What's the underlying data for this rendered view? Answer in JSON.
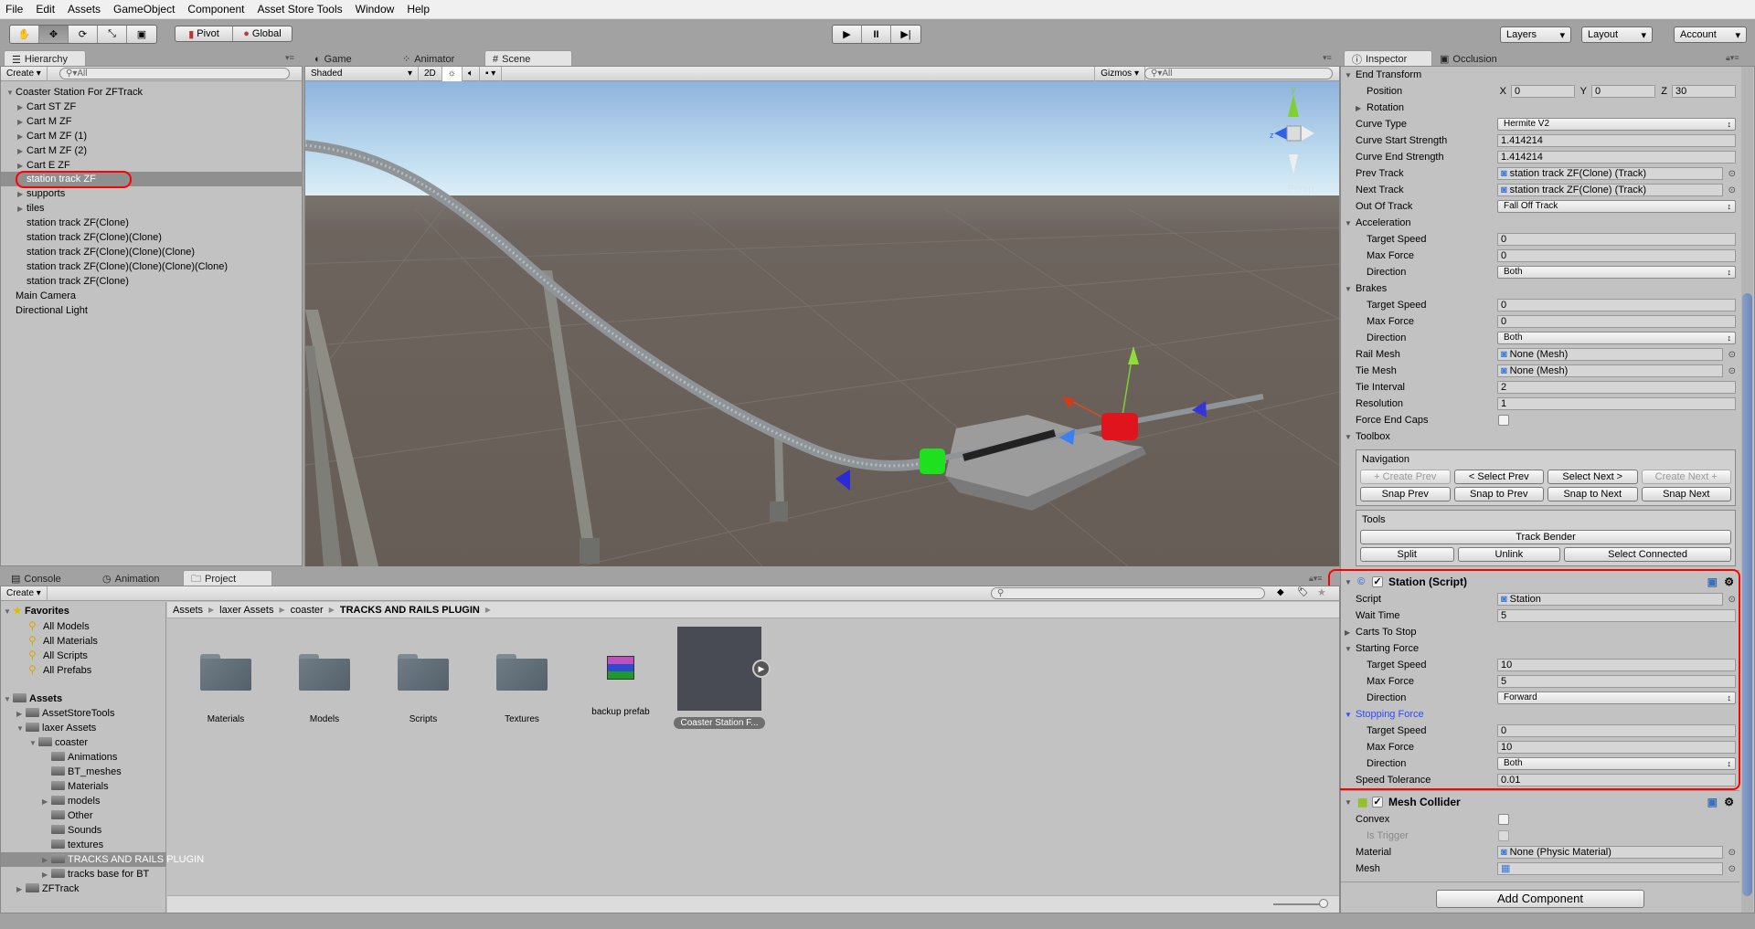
{
  "menu": [
    "File",
    "Edit",
    "Assets",
    "GameObject",
    "Component",
    "Asset Store Tools",
    "Window",
    "Help"
  ],
  "toolbar": {
    "pivot": "Pivot",
    "global": "Global",
    "layers": "Layers",
    "layout": "Layout",
    "account": "Account"
  },
  "hierarchy": {
    "tab": "Hierarchy",
    "create": "Create",
    "search_placeholder": "All",
    "items": [
      {
        "label": "Coaster Station For ZFTrack",
        "depth": 0,
        "expander": "open"
      },
      {
        "label": "Cart ST ZF",
        "depth": 1,
        "expander": "closed"
      },
      {
        "label": "Cart M ZF",
        "depth": 1,
        "expander": "closed"
      },
      {
        "label": "Cart M ZF (1)",
        "depth": 1,
        "expander": "closed"
      },
      {
        "label": "Cart M ZF (2)",
        "depth": 1,
        "expander": "closed"
      },
      {
        "label": "Cart E ZF",
        "depth": 1,
        "expander": "closed"
      },
      {
        "label": "station track ZF",
        "depth": 1,
        "selected": true
      },
      {
        "label": "supports",
        "depth": 1,
        "expander": "closed"
      },
      {
        "label": "tiles",
        "depth": 1,
        "expander": "closed"
      },
      {
        "label": "station track ZF(Clone)",
        "depth": 1
      },
      {
        "label": "station track ZF(Clone)(Clone)",
        "depth": 1
      },
      {
        "label": "station track ZF(Clone)(Clone)(Clone)",
        "depth": 1
      },
      {
        "label": "station track ZF(Clone)(Clone)(Clone)(Clone)",
        "depth": 1
      },
      {
        "label": "station track ZF(Clone)",
        "depth": 1
      },
      {
        "label": "Main Camera",
        "depth": 0
      },
      {
        "label": "Directional Light",
        "depth": 0
      }
    ]
  },
  "scene": {
    "tabs": [
      "Game",
      "Animator",
      "Scene"
    ],
    "active_tab": "Scene",
    "shading": "Shaded",
    "mode_2d": "2D",
    "gizmos": "Gizmos",
    "search_placeholder": "All",
    "persp": "Persp",
    "axis_y": "y",
    "axis_z": "z"
  },
  "inspector": {
    "tabs": [
      "Inspector",
      "Occlusion"
    ],
    "rows": [
      {
        "fold": "End Transform",
        "open": true
      },
      {
        "label": "Position",
        "depth": 1,
        "vec": [
          {
            "axis": "X",
            "value": "0"
          },
          {
            "axis": "Y",
            "value": "0"
          },
          {
            "axis": "Z",
            "value": "30"
          }
        ]
      },
      {
        "fold": "Rotation",
        "open": false,
        "depth": 1
      },
      {
        "label": "Curve Type",
        "select": "Hermite V2"
      },
      {
        "label": "Curve Start Strength",
        "value": "1.414214"
      },
      {
        "label": "Curve End Strength",
        "value": "1.414214"
      },
      {
        "label": "Prev Track",
        "object": "station track  ZF(Clone) (Track)"
      },
      {
        "label": "Next Track",
        "object": "station track  ZF(Clone) (Track)"
      },
      {
        "label": "Out Of Track",
        "select": "Fall Off Track"
      },
      {
        "fold": "Acceleration",
        "open": true
      },
      {
        "label": "Target Speed",
        "depth": 1,
        "value": "0"
      },
      {
        "label": "Max Force",
        "depth": 1,
        "value": "0"
      },
      {
        "label": "Direction",
        "depth": 1,
        "select": "Both"
      },
      {
        "fold": "Brakes",
        "open": true
      },
      {
        "label": "Target Speed",
        "depth": 1,
        "value": "0"
      },
      {
        "label": "Max Force",
        "depth": 1,
        "value": "0"
      },
      {
        "label": "Direction",
        "depth": 1,
        "select": "Both"
      },
      {
        "label": "Rail Mesh",
        "object": "None (Mesh)"
      },
      {
        "label": "Tie Mesh",
        "object": "None (Mesh)"
      },
      {
        "label": "Tie Interval",
        "value": "2"
      },
      {
        "label": "Resolution",
        "value": "1"
      },
      {
        "label": "Force End Caps",
        "checked": false
      },
      {
        "fold": "Toolbox",
        "open": true
      }
    ],
    "navigation": {
      "title": "Navigation",
      "row1": [
        {
          "label": "+ Create Prev",
          "enabled": false
        },
        {
          "label": "< Select Prev",
          "enabled": true
        },
        {
          "label": "Select Next >",
          "enabled": true
        },
        {
          "label": "Create Next +",
          "enabled": false
        }
      ],
      "row2": [
        {
          "label": "Snap Prev",
          "enabled": true
        },
        {
          "label": "Snap to Prev",
          "enabled": true
        },
        {
          "label": "Snap to Next",
          "enabled": true
        },
        {
          "label": "Snap Next",
          "enabled": true
        }
      ]
    },
    "tools": {
      "title": "Tools",
      "track_bender": "Track Bender",
      "split": "Split",
      "unlink": "Unlink",
      "select_connected": "Select Connected"
    },
    "station": {
      "title": "Station (Script)",
      "enabled": true,
      "rows": [
        {
          "label": "Script",
          "object": "Station"
        },
        {
          "label": "Wait Time",
          "value": "5"
        },
        {
          "fold": "Carts To Stop",
          "open": false
        },
        {
          "fold": "Starting Force",
          "open": true
        },
        {
          "label": "Target Speed",
          "depth": 1,
          "value": "10"
        },
        {
          "label": "Max Force",
          "depth": 1,
          "value": "5"
        },
        {
          "label": "Direction",
          "depth": 1,
          "select": "Forward"
        },
        {
          "fold": "Stopping Force",
          "open": true,
          "focused": true
        },
        {
          "label": "Target Speed",
          "depth": 1,
          "value": "0"
        },
        {
          "label": "Max Force",
          "depth": 1,
          "value": "10"
        },
        {
          "label": "Direction",
          "depth": 1,
          "select": "Both"
        },
        {
          "label": "Speed Tolerance",
          "value": "0.01"
        }
      ]
    },
    "mesh_collider": {
      "title": "Mesh Collider",
      "enabled": true,
      "rows": [
        {
          "label": "Convex",
          "checked": false
        },
        {
          "label": "Is Trigger",
          "depth": 1,
          "checked": false,
          "disabled": true
        },
        {
          "label": "Material",
          "object": "None (Physic Material)"
        },
        {
          "label": "Mesh",
          "object": ""
        }
      ]
    },
    "add_component": "Add Component"
  },
  "bottom": {
    "tabs": [
      "Console",
      "Animation",
      "Project"
    ],
    "active_tab": "Project",
    "create": "Create",
    "favorites": {
      "title": "Favorites",
      "items": [
        "All Models",
        "All Materials",
        "All Scripts",
        "All Prefabs"
      ]
    },
    "tree": [
      {
        "label": "Assets",
        "depth": 0,
        "expander": "open",
        "bold": true
      },
      {
        "label": "AssetStoreTools",
        "depth": 1,
        "expander": "closed"
      },
      {
        "label": "laxer Assets",
        "depth": 1,
        "expander": "open"
      },
      {
        "label": "coaster",
        "depth": 2,
        "expander": "open"
      },
      {
        "label": "Animations",
        "depth": 3
      },
      {
        "label": "BT_meshes",
        "depth": 3
      },
      {
        "label": "Materials",
        "depth": 3
      },
      {
        "label": "models",
        "depth": 3,
        "expander": "closed"
      },
      {
        "label": "Other",
        "depth": 3
      },
      {
        "label": "Sounds",
        "depth": 3
      },
      {
        "label": "textures",
        "depth": 3
      },
      {
        "label": "TRACKS AND RAILS PLUGIN",
        "depth": 3,
        "expander": "closed",
        "selected": true
      },
      {
        "label": "tracks base for BT",
        "depth": 3,
        "expander": "closed"
      },
      {
        "label": "ZFTrack",
        "depth": 1,
        "expander": "closed"
      }
    ],
    "breadcrumb": [
      "Assets",
      "laxer Assets",
      "coaster",
      "TRACKS AND RAILS PLUGIN"
    ],
    "items": [
      {
        "label": "Materials",
        "kind": "folder"
      },
      {
        "label": "Models",
        "kind": "folder"
      },
      {
        "label": "Scripts",
        "kind": "folder"
      },
      {
        "label": "Textures",
        "kind": "folder"
      },
      {
        "label": "backup prefab",
        "kind": "archive"
      },
      {
        "label": "Coaster Station F...",
        "kind": "prefab",
        "selected": true
      }
    ]
  },
  "colors": {
    "highlight": "#ff0000",
    "selection": "#8f8f8f",
    "focus_blue": "#2b4bff"
  }
}
